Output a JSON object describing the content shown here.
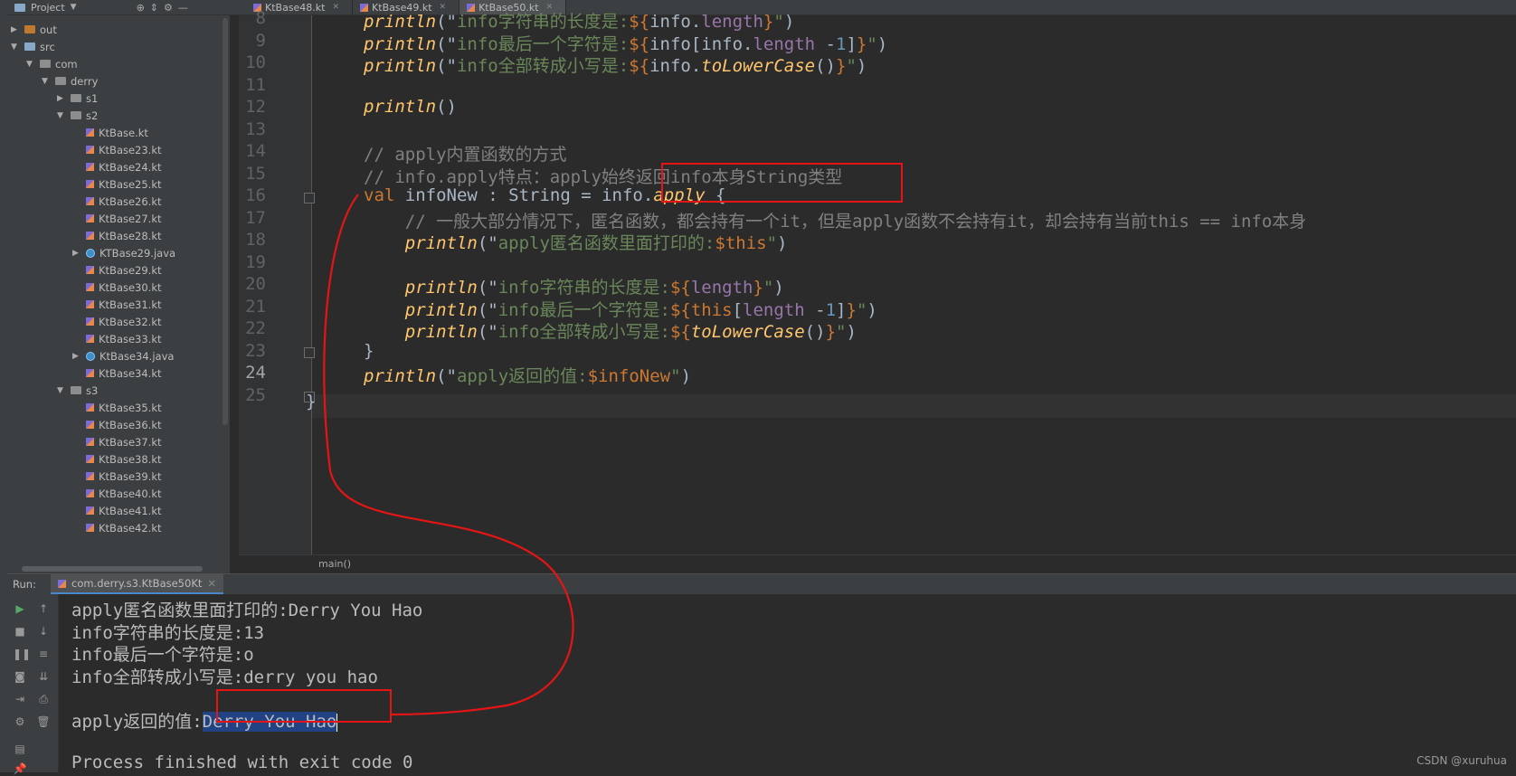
{
  "topbar": {
    "project_label": "Project",
    "tabs": [
      {
        "label": "KtBase48.kt",
        "active": false
      },
      {
        "label": "KtBase49.kt",
        "active": false
      },
      {
        "label": "KtBase50.kt",
        "active": true
      }
    ]
  },
  "tree": {
    "items": [
      {
        "label": "out",
        "kind": "folder-orange",
        "indent": 0,
        "arrow": "right"
      },
      {
        "label": "src",
        "kind": "folder-blue",
        "indent": 0,
        "arrow": "down"
      },
      {
        "label": "com",
        "kind": "folder",
        "indent": 1,
        "arrow": "down"
      },
      {
        "label": "derry",
        "kind": "folder",
        "indent": 2,
        "arrow": "down"
      },
      {
        "label": "s1",
        "kind": "folder",
        "indent": 3,
        "arrow": "right"
      },
      {
        "label": "s2",
        "kind": "folder",
        "indent": 3,
        "arrow": "down"
      },
      {
        "label": "KtBase.kt",
        "kind": "kt",
        "indent": 4,
        "arrow": ""
      },
      {
        "label": "KtBase23.kt",
        "kind": "kt",
        "indent": 4,
        "arrow": ""
      },
      {
        "label": "KtBase24.kt",
        "kind": "kt",
        "indent": 4,
        "arrow": ""
      },
      {
        "label": "KtBase25.kt",
        "kind": "kt",
        "indent": 4,
        "arrow": ""
      },
      {
        "label": "KtBase26.kt",
        "kind": "kt",
        "indent": 4,
        "arrow": ""
      },
      {
        "label": "KtBase27.kt",
        "kind": "kt",
        "indent": 4,
        "arrow": ""
      },
      {
        "label": "KtBase28.kt",
        "kind": "kt",
        "indent": 4,
        "arrow": ""
      },
      {
        "label": "KTBase29.java",
        "kind": "java",
        "indent": 4,
        "arrow": "right"
      },
      {
        "label": "KtBase29.kt",
        "kind": "kt",
        "indent": 4,
        "arrow": ""
      },
      {
        "label": "KtBase30.kt",
        "kind": "kt",
        "indent": 4,
        "arrow": ""
      },
      {
        "label": "KtBase31.kt",
        "kind": "kt",
        "indent": 4,
        "arrow": ""
      },
      {
        "label": "KtBase32.kt",
        "kind": "kt",
        "indent": 4,
        "arrow": ""
      },
      {
        "label": "KtBase33.kt",
        "kind": "kt",
        "indent": 4,
        "arrow": ""
      },
      {
        "label": "KtBase34.java",
        "kind": "java",
        "indent": 4,
        "arrow": "right"
      },
      {
        "label": "KtBase34.kt",
        "kind": "kt",
        "indent": 4,
        "arrow": ""
      },
      {
        "label": "s3",
        "kind": "folder",
        "indent": 3,
        "arrow": "down"
      },
      {
        "label": "KtBase35.kt",
        "kind": "kt",
        "indent": 4,
        "arrow": ""
      },
      {
        "label": "KtBase36.kt",
        "kind": "kt",
        "indent": 4,
        "arrow": ""
      },
      {
        "label": "KtBase37.kt",
        "kind": "kt",
        "indent": 4,
        "arrow": ""
      },
      {
        "label": "KtBase38.kt",
        "kind": "kt",
        "indent": 4,
        "arrow": ""
      },
      {
        "label": "KtBase39.kt",
        "kind": "kt",
        "indent": 4,
        "arrow": ""
      },
      {
        "label": "KtBase40.kt",
        "kind": "kt",
        "indent": 4,
        "arrow": ""
      },
      {
        "label": "KtBase41.kt",
        "kind": "kt",
        "indent": 4,
        "arrow": ""
      },
      {
        "label": "KtBase42.kt",
        "kind": "kt",
        "indent": 4,
        "arrow": ""
      }
    ]
  },
  "editor": {
    "current_line": "24",
    "lines": [
      {
        "n": "8",
        "code": [
          [
            "println",
            "fn"
          ],
          [
            "(\"",
            "txt"
          ],
          [
            "info字符串的长度是:",
            "str"
          ],
          [
            "${",
            "tpl"
          ],
          [
            "info.",
            "txt"
          ],
          [
            "length",
            "prop"
          ],
          [
            "}",
            "tpl"
          ],
          [
            "\"",
            "str"
          ],
          [
            ")",
            "txt"
          ]
        ]
      },
      {
        "n": "9",
        "code": [
          [
            "println",
            "fn"
          ],
          [
            "(\"",
            "txt"
          ],
          [
            "info最后一个字符是:",
            "str"
          ],
          [
            "${",
            "tpl"
          ],
          [
            "info[info.",
            "txt"
          ],
          [
            "length",
            "prop"
          ],
          [
            " -",
            "txt"
          ],
          [
            "1",
            "num"
          ],
          [
            "]",
            "txt"
          ],
          [
            "}",
            "tpl"
          ],
          [
            "\"",
            "str"
          ],
          [
            ")",
            "txt"
          ]
        ]
      },
      {
        "n": "10",
        "code": [
          [
            "println",
            "fn"
          ],
          [
            "(\"",
            "txt"
          ],
          [
            "info全部转成小写是:",
            "str"
          ],
          [
            "${",
            "tpl"
          ],
          [
            "info.",
            "txt"
          ],
          [
            "toLowerCase",
            "itfn"
          ],
          [
            "()",
            "txt"
          ],
          [
            "}",
            "tpl"
          ],
          [
            "\"",
            "str"
          ],
          [
            ")",
            "txt"
          ]
        ]
      },
      {
        "n": "11",
        "code": []
      },
      {
        "n": "12",
        "code": [
          [
            "println",
            "fn"
          ],
          [
            "()",
            "txt"
          ]
        ]
      },
      {
        "n": "13",
        "code": []
      },
      {
        "n": "14",
        "code": [
          [
            "// apply内置函数的方式",
            "cmt"
          ]
        ]
      },
      {
        "n": "15",
        "code": [
          [
            "// info.apply特点：apply始终返回info本身String类型",
            "cmt"
          ]
        ]
      },
      {
        "n": "16",
        "code": [
          [
            "val ",
            "kw"
          ],
          [
            "infoNew : String = info.",
            "txt"
          ],
          [
            "apply",
            "itfn"
          ],
          [
            " {",
            "txt"
          ]
        ]
      },
      {
        "n": "17",
        "code": [
          [
            "    // 一般大部分情况下，匿名函数，都会持有一个it，但是apply函数不会持有it，却会持有当前this == info本身",
            "cmt"
          ]
        ]
      },
      {
        "n": "18",
        "code": [
          [
            "    ",
            "txt"
          ],
          [
            "println",
            "fn"
          ],
          [
            "(\"",
            "txt"
          ],
          [
            "apply匿名函数里面打印的:",
            "str"
          ],
          [
            "$this",
            "tpl"
          ],
          [
            "\"",
            "str"
          ],
          [
            ")",
            "txt"
          ]
        ]
      },
      {
        "n": "19",
        "code": []
      },
      {
        "n": "20",
        "code": [
          [
            "    ",
            "txt"
          ],
          [
            "println",
            "fn"
          ],
          [
            "(\"",
            "txt"
          ],
          [
            "info字符串的长度是:",
            "str"
          ],
          [
            "${",
            "tpl"
          ],
          [
            "length",
            "prop"
          ],
          [
            "}",
            "tpl"
          ],
          [
            "\"",
            "str"
          ],
          [
            ")",
            "txt"
          ]
        ]
      },
      {
        "n": "21",
        "code": [
          [
            "    ",
            "txt"
          ],
          [
            "println",
            "fn"
          ],
          [
            "(\"",
            "txt"
          ],
          [
            "info最后一个字符是:",
            "str"
          ],
          [
            "${",
            "tpl"
          ],
          [
            "this",
            "kw"
          ],
          [
            "[",
            "txt"
          ],
          [
            "length",
            "prop"
          ],
          [
            " -",
            "txt"
          ],
          [
            "1",
            "num"
          ],
          [
            "]",
            "txt"
          ],
          [
            "}",
            "tpl"
          ],
          [
            "\"",
            "str"
          ],
          [
            ")",
            "txt"
          ]
        ]
      },
      {
        "n": "22",
        "code": [
          [
            "    ",
            "txt"
          ],
          [
            "println",
            "fn"
          ],
          [
            "(\"",
            "txt"
          ],
          [
            "info全部转成小写是:",
            "str"
          ],
          [
            "${",
            "tpl"
          ],
          [
            "toLowerCase",
            "itfn"
          ],
          [
            "()",
            "txt"
          ],
          [
            "}",
            "tpl"
          ],
          [
            "\"",
            "str"
          ],
          [
            ")",
            "txt"
          ]
        ]
      },
      {
        "n": "23",
        "code": [
          [
            "}",
            "txt"
          ]
        ]
      },
      {
        "n": "24",
        "code": [
          [
            "println",
            "fn"
          ],
          [
            "(\"",
            "txt"
          ],
          [
            "apply返回的值:",
            "str"
          ],
          [
            "$infoNew",
            "tpl"
          ],
          [
            "\"",
            "str"
          ],
          [
            ")",
            "txt"
          ]
        ]
      },
      {
        "n": "25",
        "code": []
      }
    ],
    "closing_brace": "}",
    "breadcrumb": "main()"
  },
  "run": {
    "label": "Run:",
    "tab_label": "com.derry.s3.KtBase50Kt",
    "output": [
      "apply匿名函数里面打印的:Derry You Hao",
      "info字符串的长度是:13",
      "info最后一个字符是:o",
      "info全部转成小写是:derry you hao",
      ""
    ],
    "last_prefix": "apply返回的值:",
    "last_selected": "Derry You Hao",
    "exit": "Process finished with exit code 0"
  },
  "watermark": "CSDN @xuruhua",
  "colors": {
    "annotation": "#e51515",
    "selection": "#214283"
  }
}
